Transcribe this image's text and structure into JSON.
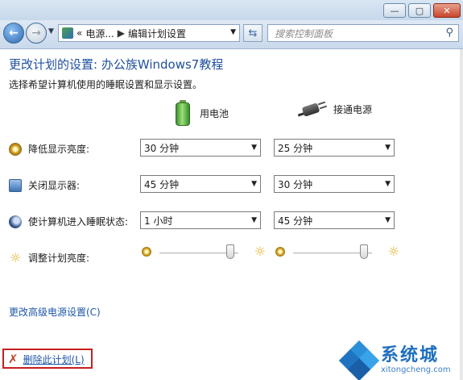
{
  "address": {
    "prefix": "«",
    "crumb1": "电源...",
    "separator": "▶",
    "crumb2": "编辑计划设置"
  },
  "search": {
    "placeholder": "搜索控制面板"
  },
  "window_buttons": {
    "minimize": "—",
    "maximize": "▢",
    "close": "✕"
  },
  "page": {
    "title": "更改计划的设置: 办公族Windows7教程",
    "subtitle": "选择希望计算机使用的睡眠设置和显示设置。"
  },
  "columns": {
    "battery": "用电池",
    "plugged": "接通电源"
  },
  "rows": [
    {
      "label": "降低显示亮度:",
      "battery": "30 分钟",
      "plugged": "25 分钟",
      "icon": "dim-display-icon"
    },
    {
      "label": "关闭显示器:",
      "battery": "45 分钟",
      "plugged": "30 分钟",
      "icon": "display-off-icon"
    },
    {
      "label": "使计算机进入睡眠状态:",
      "battery": "1 小时",
      "plugged": "45 分钟",
      "icon": "sleep-icon"
    }
  ],
  "brightness": {
    "label": "调整计划亮度:",
    "battery_level": 0.9,
    "plugged_level": 0.9
  },
  "links": {
    "advanced": "更改高级电源设置(C)",
    "delete": "删除此计划(L)"
  },
  "watermark": {
    "cn": "系统城",
    "en": "xitongcheng.com"
  }
}
